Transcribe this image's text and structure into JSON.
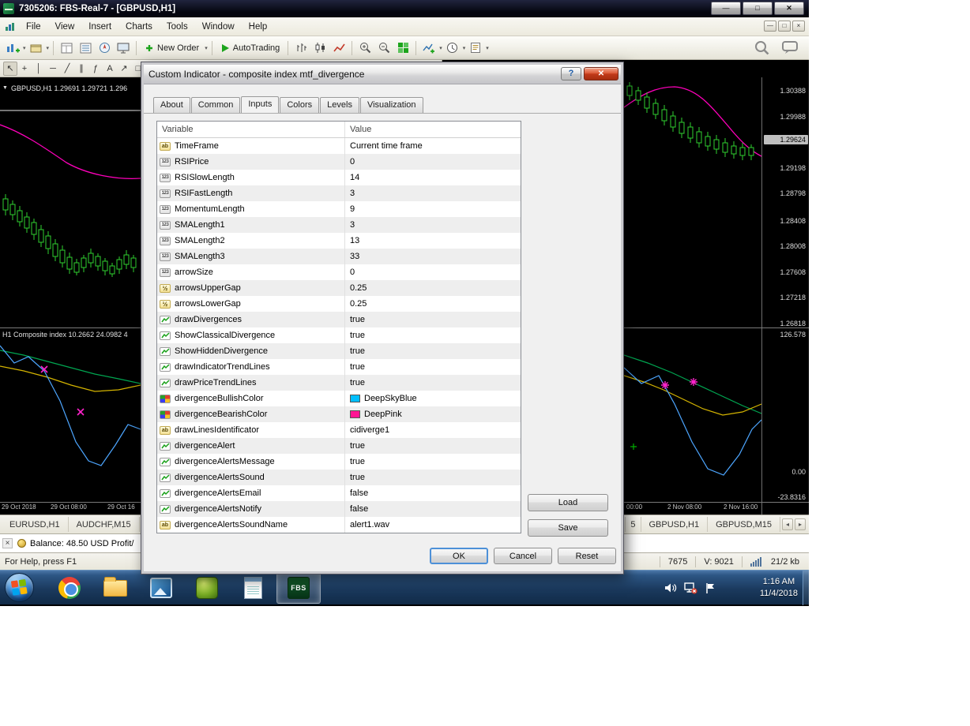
{
  "titlebar": {
    "title": "7305206: FBS-Real-7 - [GBPUSD,H1]"
  },
  "menubar": {
    "items": [
      "File",
      "View",
      "Insert",
      "Charts",
      "Tools",
      "Window",
      "Help"
    ]
  },
  "toolbar": {
    "new_order": "New Order",
    "autotrading": "AutoTrading"
  },
  "drawbar": {
    "tools": [
      "cursor",
      "crosshair",
      "vertical-line",
      "horizontal-line",
      "trendline",
      "channel",
      "fibonacci",
      "text",
      "arrow",
      "shapes"
    ],
    "glyphs": [
      "↖",
      "+",
      "│",
      "─",
      "╱",
      "∥",
      "ƒ",
      "A",
      "↗",
      "□"
    ]
  },
  "chart": {
    "symbol_line": "GBPUSD,H1 1.29691 1.29721 1.296",
    "indicator_line": "H1 Composite index 10.2662 24.0982 4",
    "price_scale": [
      "1.30388",
      "1.29988",
      "1.29624",
      "1.29198",
      "1.28798",
      "1.28408",
      "1.28008",
      "1.27608",
      "1.27218",
      "1.26818"
    ],
    "current_price_index": 2,
    "indicator_scale": {
      "max": "126.578",
      "zero": "0.00",
      "min": "-23.8316"
    },
    "time_axis_left": [
      "29 Oct 2018",
      "29 Oct 08:00",
      "29 Oct 16"
    ],
    "time_axis_right": [
      "00:00",
      "2 Nov 08:00",
      "2 Nov 16:00"
    ]
  },
  "dialog": {
    "title": "Custom Indicator - composite index mtf_divergence",
    "tabs": [
      "About",
      "Common",
      "Inputs",
      "Colors",
      "Levels",
      "Visualization"
    ],
    "active_tab": "Inputs",
    "columns": [
      "Variable",
      "Value"
    ],
    "rows": [
      {
        "name": "TimeFrame",
        "value": "Current time frame",
        "type": "string"
      },
      {
        "name": "RSIPrice",
        "value": "0",
        "type": "int"
      },
      {
        "name": "RSISlowLength",
        "value": "14",
        "type": "int"
      },
      {
        "name": "RSIFastLength",
        "value": "3",
        "type": "int"
      },
      {
        "name": "MomentumLength",
        "value": "9",
        "type": "int"
      },
      {
        "name": "SMALength1",
        "value": "3",
        "type": "int"
      },
      {
        "name": "SMALength2",
        "value": "13",
        "type": "int"
      },
      {
        "name": "SMALength3",
        "value": "33",
        "type": "int"
      },
      {
        "name": "arrowSize",
        "value": "0",
        "type": "int"
      },
      {
        "name": "arrowsUpperGap",
        "value": "0.25",
        "type": "double"
      },
      {
        "name": "arrowsLowerGap",
        "value": "0.25",
        "type": "double"
      },
      {
        "name": "drawDivergences",
        "value": "true",
        "type": "bool"
      },
      {
        "name": "ShowClassicalDivergence",
        "value": "true",
        "type": "bool"
      },
      {
        "name": "ShowHiddenDivergence",
        "value": "true",
        "type": "bool"
      },
      {
        "name": "drawIndicatorTrendLines",
        "value": "true",
        "type": "bool"
      },
      {
        "name": "drawPriceTrendLines",
        "value": "true",
        "type": "bool"
      },
      {
        "name": "divergenceBullishColor",
        "value": "DeepSkyBlue",
        "type": "color",
        "swatch": "#00BFFF"
      },
      {
        "name": "divergenceBearishColor",
        "value": "DeepPink",
        "type": "color",
        "swatch": "#FF1493"
      },
      {
        "name": "drawLinesIdentificator",
        "value": "cidiverge1",
        "type": "string"
      },
      {
        "name": "divergenceAlert",
        "value": "true",
        "type": "bool"
      },
      {
        "name": "divergenceAlertsMessage",
        "value": "true",
        "type": "bool"
      },
      {
        "name": "divergenceAlertsSound",
        "value": "true",
        "type": "bool"
      },
      {
        "name": "divergenceAlertsEmail",
        "value": "false",
        "type": "bool"
      },
      {
        "name": "divergenceAlertsNotify",
        "value": "false",
        "type": "bool"
      },
      {
        "name": "divergenceAlertsSoundName",
        "value": "alert1.wav",
        "type": "string"
      }
    ],
    "buttons": {
      "load": "Load",
      "save": "Save",
      "ok": "OK",
      "cancel": "Cancel",
      "reset": "Reset"
    }
  },
  "chart_tabs": {
    "left": [
      "EURUSD,H1",
      "AUDCHF,M15"
    ],
    "right_partial": "5",
    "right": [
      "GBPUSD,H1",
      "GBPUSD,M15"
    ]
  },
  "terminal": {
    "balance_line": "Balance: 48.50 USD  Profit/"
  },
  "statusbar": {
    "help_text": "For Help, press F1",
    "item1": "7675",
    "item2": "V: 9021",
    "item3": "21/2 kb"
  },
  "taskbar": {
    "clock_time": "1:16 AM",
    "clock_date": "11/4/2018",
    "fbs_label": "FBS"
  },
  "icons": {
    "caret": "▾",
    "min": "—",
    "max": "□",
    "close": "✕",
    "help": "?",
    "prev": "◂",
    "next": "▸",
    "panel_close": "×",
    "dropdown": "▼",
    "type_string": "ab",
    "type_int": "123",
    "type_double": "½"
  }
}
